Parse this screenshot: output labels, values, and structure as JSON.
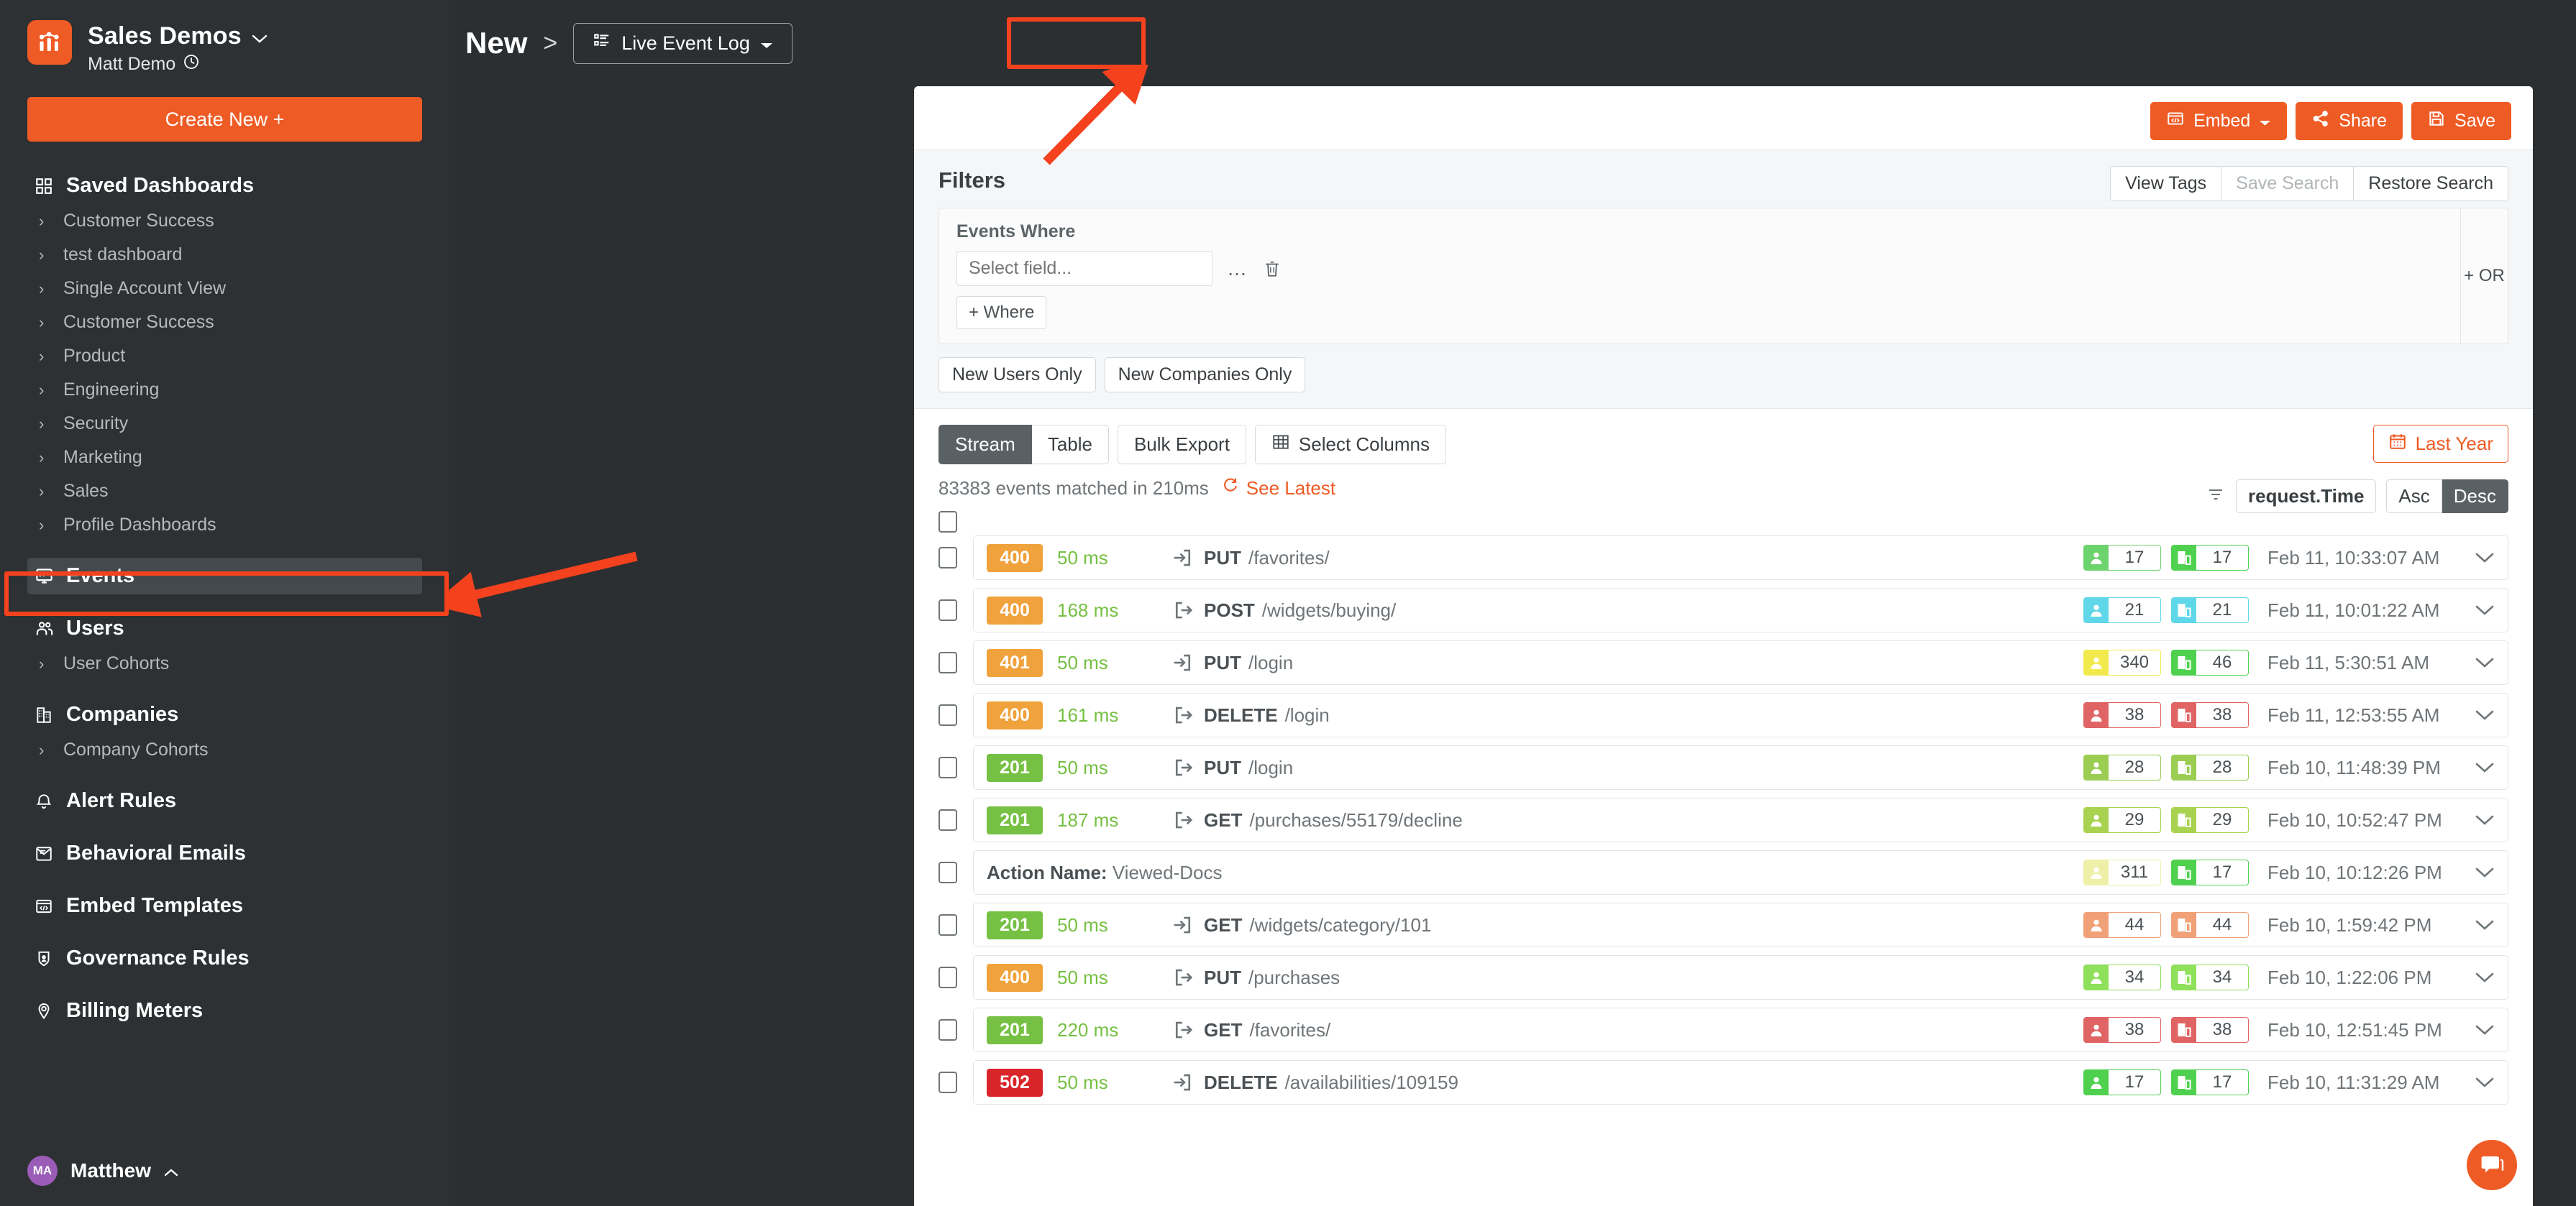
{
  "sidebar": {
    "workspace": "Sales Demos",
    "account": "Matt Demo",
    "create_button": "Create New +",
    "saved_dashboards_label": "Saved Dashboards",
    "dashboards": [
      "Customer Success",
      "test dashboard",
      "Single Account View",
      "Customer Success",
      "Product",
      "Engineering",
      "Security",
      "Marketing",
      "Sales",
      "Profile Dashboards"
    ],
    "events_label": "Events",
    "users_label": "Users",
    "user_cohorts_label": "User Cohorts",
    "companies_label": "Companies",
    "company_cohorts_label": "Company Cohorts",
    "alert_rules_label": "Alert Rules",
    "behavioral_emails_label": "Behavioral Emails",
    "embed_templates_label": "Embed Templates",
    "governance_rules_label": "Governance Rules",
    "billing_meters_label": "Billing Meters",
    "user_name": "Matthew",
    "user_initials": "MA"
  },
  "header": {
    "breadcrumb_root": "New",
    "breadcrumb_sep": ">",
    "view_selector": "Live Event Log",
    "embed_label": "Embed",
    "share_label": "Share",
    "save_label": "Save"
  },
  "filters": {
    "title": "Filters",
    "view_tags": "View Tags",
    "save_search": "Save Search",
    "restore_search": "Restore Search",
    "events_where_label": "Events Where",
    "select_field_placeholder": "Select field...",
    "add_where": "+ Where",
    "or_label": "+ OR",
    "new_users_only": "New Users Only",
    "new_companies_only": "New Companies Only"
  },
  "toolbar": {
    "tabs": [
      "Stream",
      "Table"
    ],
    "active_tab": "Stream",
    "bulk_export": "Bulk Export",
    "select_columns": "Select Columns",
    "status": "83383 events matched in 210ms",
    "see_latest": "See Latest",
    "date_range": "Last Year",
    "sort_field": "request.Time",
    "sort_asc": "Asc",
    "sort_desc": "Desc",
    "sort_active": "Desc"
  },
  "colors": {
    "brand_orange": "#ef5b25",
    "status_2xx": "#76c043",
    "status_4xx": "#f0a23c",
    "status_5xx": "#d9252a",
    "duration_green": "#76c043",
    "annotation_red": "#f4411e"
  },
  "events": [
    {
      "code": "400",
      "code_class": "c4",
      "duration": "50 ms",
      "direction": "in",
      "method": "PUT",
      "path": "/favorites/",
      "user_count": "17",
      "company_count": "17",
      "pill_color": "#6dd36d",
      "pill_color2": "#4fd14f",
      "timestamp": "Feb 11, 10:33:07 AM"
    },
    {
      "code": "400",
      "code_class": "c4",
      "duration": "168 ms",
      "direction": "out",
      "method": "POST",
      "path": "/widgets/buying/",
      "user_count": "21",
      "company_count": "21",
      "pill_color": "#5fd7e8",
      "pill_color2": "#5fd7e8",
      "timestamp": "Feb 11, 10:01:22 AM"
    },
    {
      "code": "401",
      "code_class": "c4",
      "duration": "50 ms",
      "direction": "in",
      "method": "PUT",
      "path": "/login",
      "user_count": "340",
      "company_count": "46",
      "pill_color": "#f2ea4c",
      "pill_color2": "#4fd14f",
      "timestamp": "Feb 11, 5:30:51 AM"
    },
    {
      "code": "400",
      "code_class": "c4",
      "duration": "161 ms",
      "direction": "out",
      "method": "DELETE",
      "path": "/login",
      "user_count": "38",
      "company_count": "38",
      "pill_color": "#e06464",
      "pill_color2": "#e06464",
      "timestamp": "Feb 11, 12:53:55 AM"
    },
    {
      "code": "201",
      "code_class": "c2",
      "duration": "50 ms",
      "direction": "out",
      "method": "PUT",
      "path": "/login",
      "user_count": "28",
      "company_count": "28",
      "pill_color": "#9acd52",
      "pill_color2": "#9acd52",
      "timestamp": "Feb 10, 11:48:39 PM"
    },
    {
      "code": "201",
      "code_class": "c2",
      "duration": "187 ms",
      "direction": "out",
      "method": "GET",
      "path": "/purchases/55179/decline",
      "user_count": "29",
      "company_count": "29",
      "pill_color": "#a8d24f",
      "pill_color2": "#a8d24f",
      "timestamp": "Feb 10, 10:52:47 PM"
    },
    {
      "action_label": "Action Name:",
      "action_value": "Viewed-Docs",
      "user_count": "311",
      "company_count": "17",
      "pill_color": "#eff0a8",
      "pill_color2": "#4fd14f",
      "timestamp": "Feb 10, 10:12:26 PM"
    },
    {
      "code": "201",
      "code_class": "c2",
      "duration": "50 ms",
      "direction": "in",
      "method": "GET",
      "path": "/widgets/category/101",
      "user_count": "44",
      "company_count": "44",
      "pill_color": "#f0a177",
      "pill_color2": "#f0a177",
      "timestamp": "Feb 10, 1:59:42 PM"
    },
    {
      "code": "400",
      "code_class": "c4",
      "duration": "50 ms",
      "direction": "out",
      "method": "PUT",
      "path": "/purchases",
      "user_count": "34",
      "company_count": "34",
      "pill_color": "#8fe05a",
      "pill_color2": "#8fe05a",
      "timestamp": "Feb 10, 1:22:06 PM"
    },
    {
      "code": "201",
      "code_class": "c2",
      "duration": "220 ms",
      "direction": "out",
      "method": "GET",
      "path": "/favorites/",
      "user_count": "38",
      "company_count": "38",
      "pill_color": "#e06464",
      "pill_color2": "#e06464",
      "timestamp": "Feb 10, 12:51:45 PM"
    },
    {
      "code": "502",
      "code_class": "c5",
      "duration": "50 ms",
      "direction": "in",
      "method": "DELETE",
      "path": "/availabilities/109159",
      "user_count": "17",
      "company_count": "17",
      "pill_color": "#4fd14f",
      "pill_color2": "#4fd14f",
      "timestamp": "Feb 10, 11:31:29 AM"
    }
  ]
}
